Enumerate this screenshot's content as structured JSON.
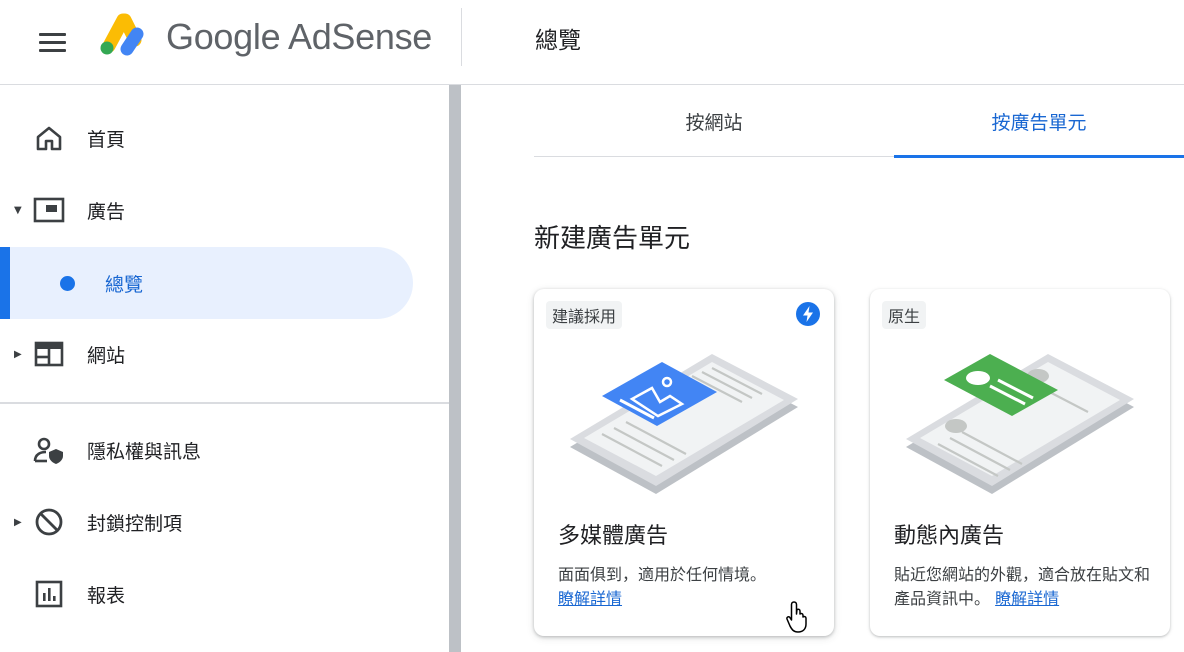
{
  "header": {
    "app_name": "Google AdSense",
    "page_title": "總覽"
  },
  "sidebar": {
    "items": [
      {
        "label": "首頁",
        "icon": "home-icon"
      },
      {
        "label": "廣告",
        "icon": "ad-units-icon"
      },
      {
        "label": "總覽",
        "icon": "dot-icon",
        "active": true
      },
      {
        "label": "網站",
        "icon": "sites-icon"
      },
      {
        "label": "隱私權與訊息",
        "icon": "privacy-icon"
      },
      {
        "label": "封鎖控制項",
        "icon": "block-icon"
      },
      {
        "label": "報表",
        "icon": "reports-icon"
      }
    ]
  },
  "tabs": [
    {
      "label": "按網站",
      "active": false
    },
    {
      "label": "按廣告單元",
      "active": true
    }
  ],
  "section_title": "新建廣告單元",
  "cards": [
    {
      "badge": "建議採用",
      "title": "多媒體廣告",
      "description": "面面俱到，適用於任何情境。",
      "link": "瞭解詳情"
    },
    {
      "badge": "原生",
      "title": "動態內廣告",
      "description": "貼近您網站的外觀，適合放在貼文和產品資訊中。",
      "link": "瞭解詳情"
    }
  ],
  "colors": {
    "accent": "#1a73e8",
    "active_bg": "#e8f0fe",
    "native_green": "#4caf50"
  }
}
